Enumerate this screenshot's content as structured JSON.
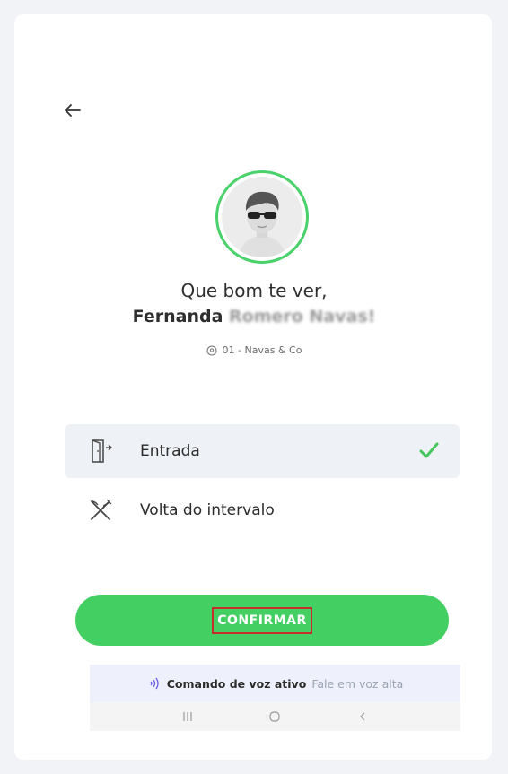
{
  "header": {
    "back_icon": "arrow-left-icon"
  },
  "profile": {
    "greeting": "Que bom te ver,",
    "first_name": "Fernanda",
    "last_name": "Romero Navas!",
    "location_icon": "location-pin-icon",
    "location": "01 - Navas & Co",
    "avatar_ring_color": "#49d16a"
  },
  "options": [
    {
      "label": "Entrada",
      "icon": "door-entry-icon",
      "selected": true,
      "check_icon": "checkmark-icon"
    },
    {
      "label": "Volta do intervalo",
      "icon": "fork-knife-icon",
      "selected": false
    }
  ],
  "confirm": {
    "label": "CONFIRMAR",
    "color": "#44cf63",
    "highlight_color": "#c62d2d"
  },
  "voice": {
    "icon": "sound-wave-icon",
    "title": "Comando de voz ativo",
    "subtitle": "Fale em voz alta"
  },
  "navbar": {
    "recents_icon": "recents-icon",
    "home_icon": "home-icon",
    "back_icon": "nav-back-icon"
  }
}
